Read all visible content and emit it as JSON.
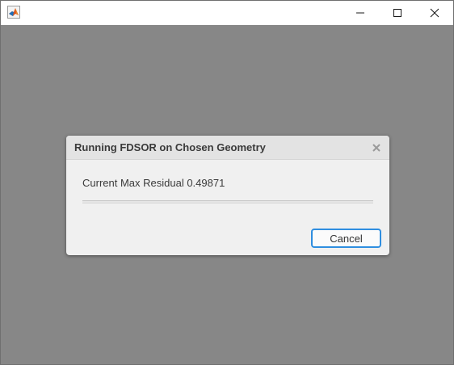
{
  "window": {
    "app_icon": "matlab-icon",
    "controls": {
      "minimize_icon": "minimize-icon",
      "maximize_icon": "maximize-icon",
      "close_icon": "close-icon"
    },
    "background_color": "#878787"
  },
  "dialog": {
    "title": "Running FDSOR on Chosen Geometry",
    "close_icon": "close-x-icon",
    "message": "Current Max Residual 0.49871",
    "progress_fraction": 0,
    "cancel_label": "Cancel",
    "accent_color": "#2f8ee0"
  }
}
